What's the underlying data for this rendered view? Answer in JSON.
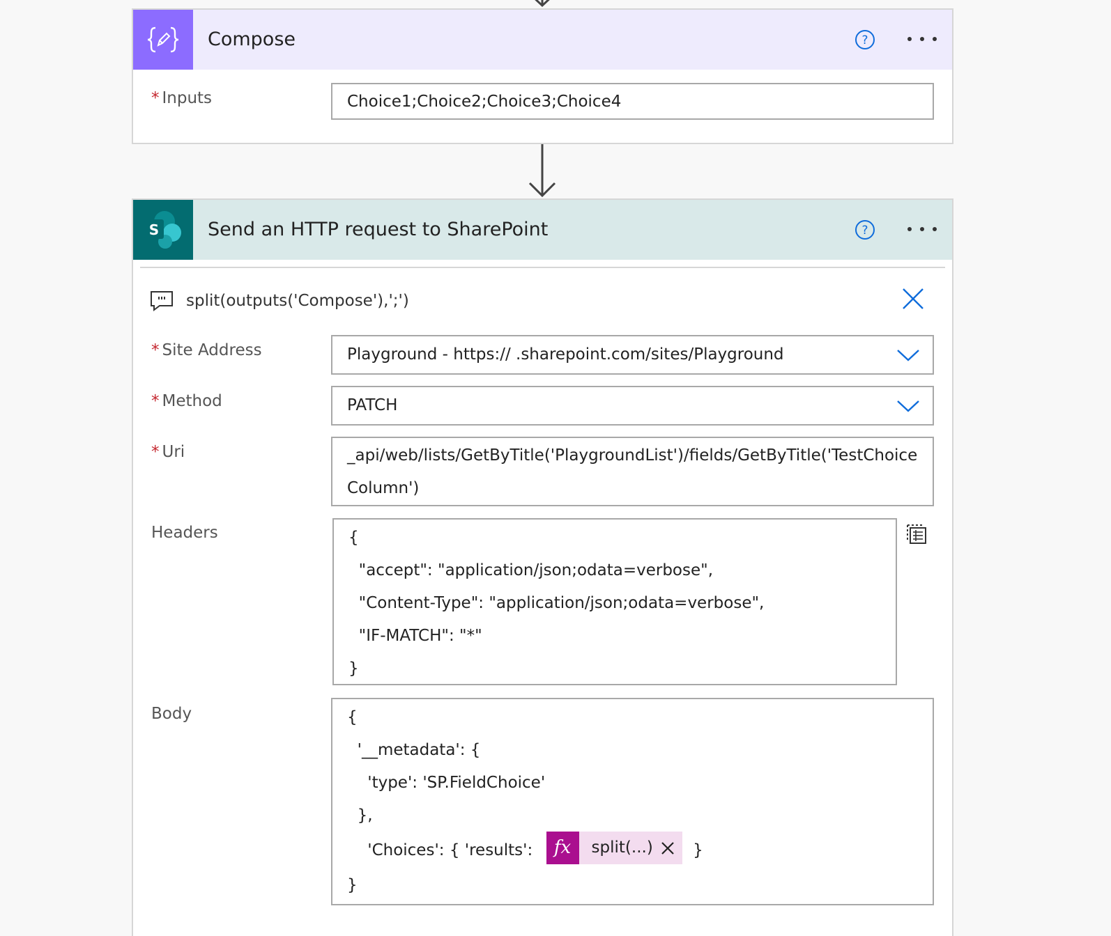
{
  "compose": {
    "title": "Compose",
    "icon": "compose-braces-icon",
    "inputs_label": "Inputs",
    "inputs_value": "Choice1;Choice2;Choice3;Choice4"
  },
  "http": {
    "title": "Send an HTTP request to SharePoint",
    "icon": "sharepoint-icon",
    "comment": "split(outputs('Compose'),';')",
    "site_address_label": "Site Address",
    "site_address_value": "Playground - https://                  .sharepoint.com/sites/Playground",
    "method_label": "Method",
    "method_value": "PATCH",
    "uri_label": "Uri",
    "uri_value": "_api/web/lists/GetByTitle('PlaygroundList')/fields/GetByTitle('TestChoiceColumn')",
    "headers_label": "Headers",
    "headers_lines": [
      "{",
      "  \"accept\": \"application/json;odata=verbose\",",
      "  \"Content-Type\": \"application/json;odata=verbose\",",
      "  \"IF-MATCH\": \"*\"",
      "}"
    ],
    "body_label": "Body",
    "body_lines": [
      "{",
      "  '__metadata': {",
      "    'type': 'SP.FieldChoice'",
      "  },",
      "    'Choices': { 'results': ",
      "}"
    ],
    "body_token": {
      "fx": "fx",
      "text": "split(...)",
      "suffix": " }"
    }
  },
  "required_marker": "*",
  "colors": {
    "compose_accent": "#8c6cff",
    "compose_header": "#eeebfd",
    "sharepoint_accent": "#036c70",
    "sharepoint_header": "#d9e9e9",
    "link_blue": "#0f6cdb",
    "required_red": "#c4262e",
    "expression_token": "#aa0f8f"
  }
}
